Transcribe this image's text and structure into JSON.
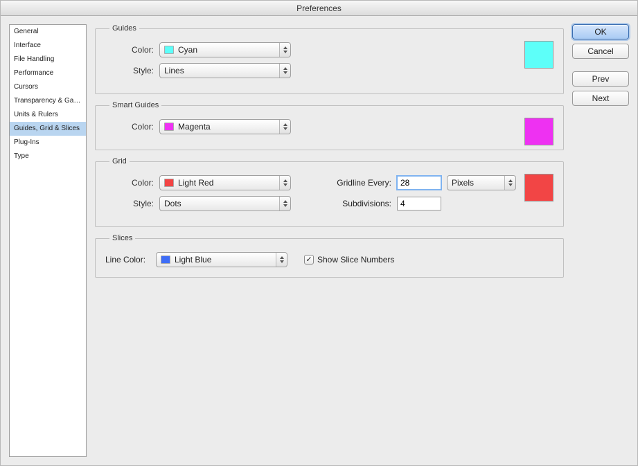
{
  "window_title": "Preferences",
  "sidebar": {
    "items": [
      "General",
      "Interface",
      "File Handling",
      "Performance",
      "Cursors",
      "Transparency & Gamut",
      "Units & Rulers",
      "Guides, Grid & Slices",
      "Plug-Ins",
      "Type"
    ],
    "selected_index": 7
  },
  "buttons": {
    "ok": "OK",
    "cancel": "Cancel",
    "prev": "Prev",
    "next": "Next"
  },
  "guides": {
    "legend": "Guides",
    "color_label": "Color:",
    "color_value": "Cyan",
    "color_hex": "#5cfff9",
    "style_label": "Style:",
    "style_value": "Lines",
    "swatch_hex": "#5dfff9"
  },
  "smart_guides": {
    "legend": "Smart Guides",
    "color_label": "Color:",
    "color_value": "Magenta",
    "color_hex": "#ef32f3",
    "swatch_hex": "#ee31f2"
  },
  "grid": {
    "legend": "Grid",
    "color_label": "Color:",
    "color_value": "Light Red",
    "color_hex": "#f24444",
    "style_label": "Style:",
    "style_value": "Dots",
    "gridline_label": "Gridline Every:",
    "gridline_value": "28",
    "gridline_unit": "Pixels",
    "subdiv_label": "Subdivisions:",
    "subdiv_value": "4",
    "swatch_hex": "#f24545"
  },
  "slices": {
    "legend": "Slices",
    "line_color_label": "Line Color:",
    "line_color_value": "Light Blue",
    "line_color_hex": "#3e6df7",
    "show_numbers_label": "Show Slice Numbers",
    "show_numbers_checked": true
  }
}
